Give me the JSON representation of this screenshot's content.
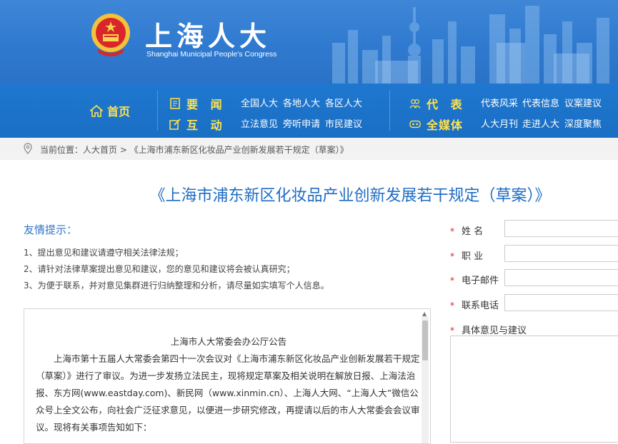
{
  "header": {
    "title": "上海人大",
    "subtitle": "Shanghai Municipal People's Congress"
  },
  "nav": {
    "home": "首页",
    "groups": [
      {
        "label": "要 闻",
        "links": [
          "全国人大",
          "各地人大",
          "各区人大"
        ]
      },
      {
        "label": "互 动",
        "links": [
          "立法意见",
          "旁听申请",
          "市民建议"
        ]
      },
      {
        "label": "代 表",
        "links": [
          "代表风采",
          "代表信息",
          "议案建议"
        ]
      },
      {
        "label": "全媒体",
        "links": [
          "人大月刊",
          "走进人大",
          "深度聚焦"
        ]
      }
    ]
  },
  "breadcrumb": "当前位置：人大首页 > 《上海市浦东新区化妆品产业创新发展若干规定（草案）》",
  "page_title": "《上海市浦东新区化妆品产业创新发展若干规定（草案）》",
  "tips": {
    "heading": "友情提示：",
    "items": [
      "1、提出意见和建议请遵守相关法律法规；",
      "2、请针对法律草案提出意见和建议，您的意见和建议将会被认真研究；",
      "3、为便于联系，并对意见集群进行归纳整理和分析，请尽量如实填写个人信息。"
    ]
  },
  "notice": {
    "heading": "上海市人大常委会办公厅公告",
    "body": "上海市第十五届人大常委会第四十一次会议对《上海市浦东新区化妆品产业创新发展若干规定（草案）》进行了审议。为进一步发扬立法民主，现将规定草案及相关说明在解放日报、上海法治报、东方网(www.eastday.com)、新民网（www.xinmin.cn）、上海人大网、“上海人大”微信公众号上全文公布，向社会广泛征求意见，以便进一步研究修改，再提请以后的市人大常委会会议审议。现将有关事项告知如下："
  },
  "form": {
    "required_mark": "*",
    "name_label": "姓 名",
    "job_label": "职 业",
    "email_label": "电子邮件",
    "phone_label": "联系电话",
    "opinion_label": "具体意见与建议"
  },
  "colors": {
    "banner": "#2f7ad0",
    "nav": "#1f77cf",
    "nav_highlight": "#ffe34d",
    "title": "#1f6cc4",
    "required": "#d42020"
  }
}
